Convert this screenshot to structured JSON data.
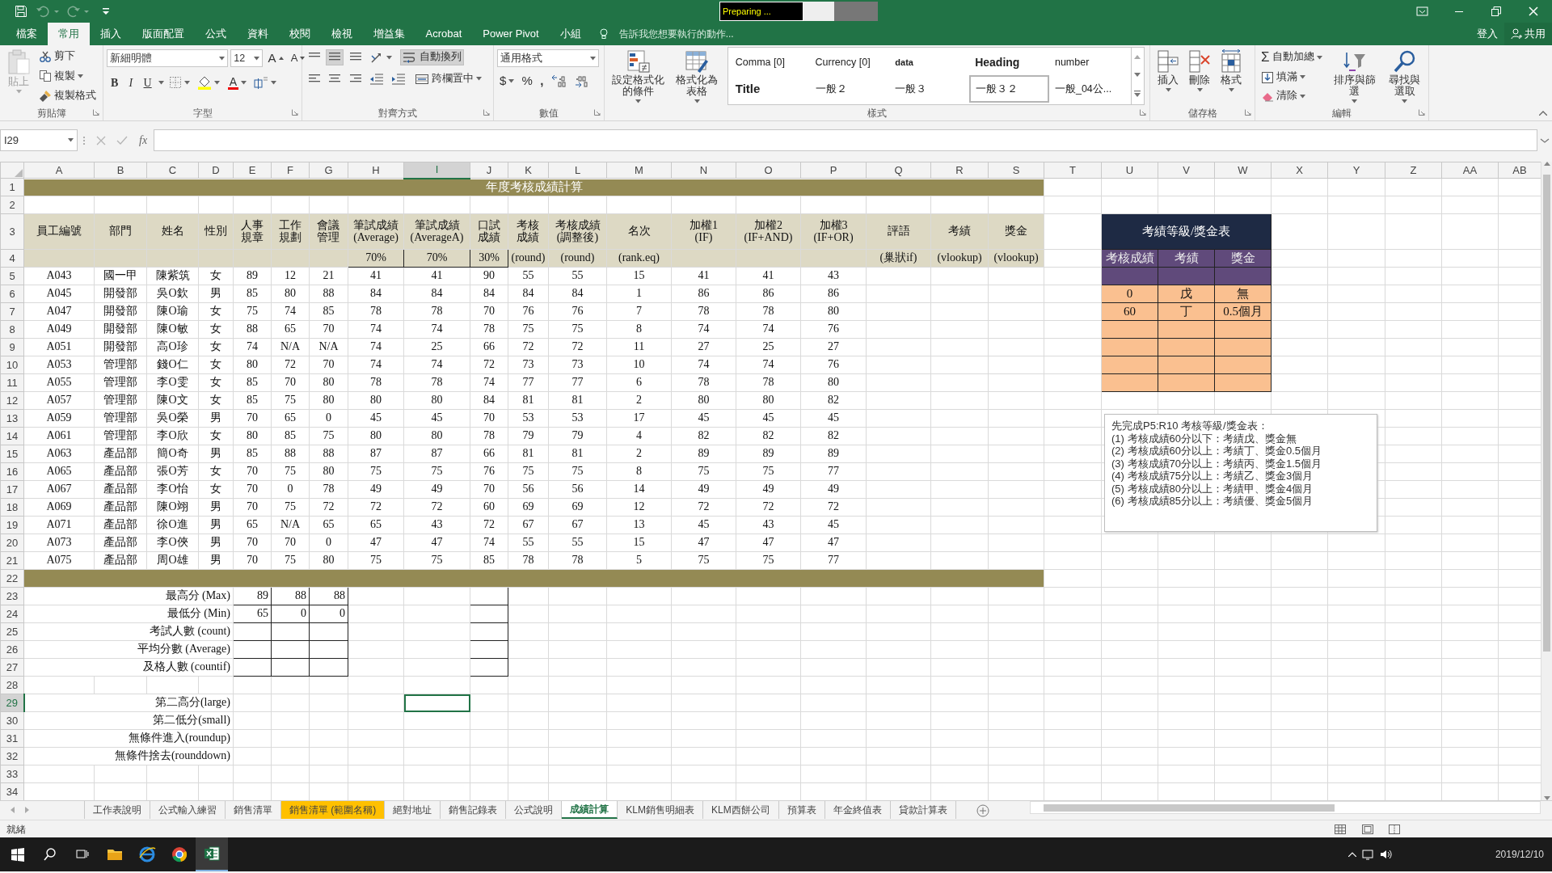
{
  "title_bar": {
    "status_box": "Preparing ..."
  },
  "menu_tabs": [
    {
      "label": "檔案",
      "selected": false
    },
    {
      "label": "常用",
      "selected": true
    },
    {
      "label": "插入",
      "selected": false
    },
    {
      "label": "版面配置",
      "selected": false
    },
    {
      "label": "公式",
      "selected": false
    },
    {
      "label": "資料",
      "selected": false
    },
    {
      "label": "校閱",
      "selected": false
    },
    {
      "label": "檢視",
      "selected": false
    },
    {
      "label": "增益集",
      "selected": false
    },
    {
      "label": "Acrobat",
      "selected": false
    },
    {
      "label": "Power Pivot",
      "selected": false
    },
    {
      "label": "小組",
      "selected": false
    }
  ],
  "tell_me": {
    "placeholder": "告訴我您想要執行的動作..."
  },
  "account": {
    "sign_in": "登入",
    "share": "共用"
  },
  "ribbon": {
    "clipboard": {
      "paste": {
        "label": "貼上",
        "disabled": true
      },
      "cut": "剪下",
      "copy": "複製",
      "format_painter": "複製格式",
      "label": "剪貼簿"
    },
    "font": {
      "font_name": "新細明體",
      "font_size": "12",
      "grow": "A",
      "shrink": "A",
      "bold": "B",
      "italic": "I",
      "underline": "U",
      "font_color": "A",
      "label": "字型"
    },
    "alignment": {
      "wrap_text": {
        "label": "自動換列",
        "on": true
      },
      "merge": "跨欄置中",
      "label": "對齊方式"
    },
    "number": {
      "format": "通用格式",
      "currency": "$",
      "percent": "%",
      "comma": ",",
      "label": "數值"
    },
    "styles": {
      "conditional": "設定格式化的條件",
      "format_table": "格式化為表格",
      "gallery": [
        {
          "name": "Comma [0]",
          "kind": "normal",
          "selected": false
        },
        {
          "name": "Currency [0]",
          "kind": "normal",
          "selected": false
        },
        {
          "name": "data",
          "kind": "small",
          "selected": false
        },
        {
          "name": "Heading",
          "kind": "heading",
          "selected": false
        },
        {
          "name": "number",
          "kind": "normal",
          "selected": false
        },
        {
          "name": "Title",
          "kind": "title",
          "selected": false
        },
        {
          "name": "一般２",
          "kind": "normal",
          "selected": false
        },
        {
          "name": "一般３",
          "kind": "normal",
          "selected": false
        },
        {
          "name": "一般３２",
          "kind": "normal",
          "selected": true
        },
        {
          "name": "一般_04公...",
          "kind": "normal",
          "selected": false
        }
      ],
      "label": "樣式"
    },
    "cells": {
      "insert": "插入",
      "delete": "刪除",
      "format": "格式",
      "label": "儲存格"
    },
    "editing": {
      "autosum_symbol": "Σ",
      "autosum": "自動加總",
      "fill": "填滿",
      "clear": "清除",
      "sort": "排序與篩選",
      "find": "尋找與選取",
      "label": "編輯"
    }
  },
  "formula_bar": {
    "name_box": "I29",
    "fx": "fx"
  },
  "sheet": {
    "columns": [
      {
        "letter": "A",
        "selected": false
      },
      {
        "letter": "B",
        "selected": false
      },
      {
        "letter": "C",
        "selected": false
      },
      {
        "letter": "D",
        "selected": false
      },
      {
        "letter": "E",
        "selected": false
      },
      {
        "letter": "F",
        "selected": false
      },
      {
        "letter": "G",
        "selected": false
      },
      {
        "letter": "H",
        "selected": false
      },
      {
        "letter": "I",
        "selected": true
      },
      {
        "letter": "J",
        "selected": false
      },
      {
        "letter": "K",
        "selected": false
      },
      {
        "letter": "L",
        "selected": false
      },
      {
        "letter": "M",
        "selected": false
      },
      {
        "letter": "N",
        "selected": false
      },
      {
        "letter": "O",
        "selected": false
      },
      {
        "letter": "P",
        "selected": false
      },
      {
        "letter": "Q",
        "selected": false
      },
      {
        "letter": "R",
        "selected": false
      },
      {
        "letter": "S",
        "selected": false
      },
      {
        "letter": "T",
        "selected": false
      },
      {
        "letter": "U",
        "selected": false
      },
      {
        "letter": "V",
        "selected": false
      },
      {
        "letter": "W",
        "selected": false
      },
      {
        "letter": "X",
        "selected": false
      },
      {
        "letter": "Y",
        "selected": false
      },
      {
        "letter": "Z",
        "selected": false
      },
      {
        "letter": "AA",
        "selected": false
      },
      {
        "letter": "AB",
        "selected": false
      }
    ],
    "rows": [
      {
        "number": "1",
        "selected": false
      },
      {
        "number": "2",
        "selected": false
      },
      {
        "number": "3",
        "selected": false
      },
      {
        "number": "4",
        "selected": false
      },
      {
        "number": "5",
        "selected": false
      },
      {
        "number": "6",
        "selected": false
      },
      {
        "number": "7",
        "selected": false
      },
      {
        "number": "8",
        "selected": false
      },
      {
        "number": "9",
        "selected": false
      },
      {
        "number": "10",
        "selected": false
      },
      {
        "number": "11",
        "selected": false
      },
      {
        "number": "12",
        "selected": false
      },
      {
        "number": "13",
        "selected": false
      },
      {
        "number": "14",
        "selected": false
      },
      {
        "number": "15",
        "selected": false
      },
      {
        "number": "16",
        "selected": false
      },
      {
        "number": "17",
        "selected": false
      },
      {
        "number": "18",
        "selected": false
      },
      {
        "number": "19",
        "selected": false
      },
      {
        "number": "20",
        "selected": false
      },
      {
        "number": "21",
        "selected": false
      },
      {
        "number": "22",
        "selected": false
      },
      {
        "number": "23",
        "selected": false
      },
      {
        "number": "24",
        "selected": false
      },
      {
        "number": "25",
        "selected": false
      },
      {
        "number": "26",
        "selected": false
      },
      {
        "number": "27",
        "selected": false
      },
      {
        "number": "28",
        "selected": false
      },
      {
        "number": "29",
        "selected": true
      },
      {
        "number": "30",
        "selected": false
      },
      {
        "number": "31",
        "selected": false
      },
      {
        "number": "32",
        "selected": false
      },
      {
        "number": "33",
        "selected": false
      },
      {
        "number": "34",
        "selected": false
      }
    ],
    "title": "年度考核成績計算",
    "header": [
      {
        "title": "員工編號"
      },
      {
        "title": "部門"
      },
      {
        "title": "姓名"
      },
      {
        "title": "性別"
      },
      {
        "title": "人事規章"
      },
      {
        "title": "工作規劃"
      },
      {
        "title": "會議管理"
      },
      {
        "title": "筆試成績\n(Average)",
        "weight": "70%"
      },
      {
        "title": "筆試成績\n(AverageA)",
        "weight": "70%"
      },
      {
        "title": "口試成績",
        "weight": "30%"
      },
      {
        "title": "考核成績",
        "note": "(round)"
      },
      {
        "title": "考核成績\n(調整後)",
        "note": "(round)"
      },
      {
        "title": "名次",
        "note": "(rank.eq)"
      },
      {
        "title": "加權1\n(IF)"
      },
      {
        "title": "加權2\n(IF+AND)"
      },
      {
        "title": "加權3\n(IF+OR)"
      },
      {
        "title": "評語",
        "note": "(巢狀if)"
      },
      {
        "title": "考績",
        "note": "(vlookup)"
      },
      {
        "title": "獎金",
        "note": "(vlookup)"
      }
    ],
    "records": [
      [
        "A043",
        "國一甲",
        "陳紫筑",
        "女",
        "89",
        "12",
        "21",
        "41",
        "41",
        "90",
        "55",
        "55",
        "15",
        "41",
        "41",
        "43"
      ],
      [
        "A045",
        "開發部",
        "吳O欽",
        "男",
        "85",
        "80",
        "88",
        "84",
        "84",
        "84",
        "84",
        "84",
        "1",
        "86",
        "86",
        "86"
      ],
      [
        "A047",
        "開發部",
        "陳O瑜",
        "女",
        "75",
        "74",
        "85",
        "78",
        "78",
        "70",
        "76",
        "76",
        "7",
        "78",
        "78",
        "80"
      ],
      [
        "A049",
        "開發部",
        "陳O敏",
        "女",
        "88",
        "65",
        "70",
        "74",
        "74",
        "78",
        "75",
        "75",
        "8",
        "74",
        "74",
        "76"
      ],
      [
        "A051",
        "開發部",
        "高O珍",
        "女",
        "74",
        "N/A",
        "N/A",
        "74",
        "25",
        "66",
        "72",
        "72",
        "11",
        "27",
        "25",
        "27"
      ],
      [
        "A053",
        "管理部",
        "錢O仁",
        "女",
        "80",
        "72",
        "70",
        "74",
        "74",
        "72",
        "73",
        "73",
        "10",
        "74",
        "74",
        "76"
      ],
      [
        "A055",
        "管理部",
        "李O雯",
        "女",
        "85",
        "70",
        "80",
        "78",
        "78",
        "74",
        "77",
        "77",
        "6",
        "78",
        "78",
        "80"
      ],
      [
        "A057",
        "管理部",
        "陳O文",
        "女",
        "85",
        "75",
        "80",
        "80",
        "80",
        "84",
        "81",
        "81",
        "2",
        "80",
        "80",
        "82"
      ],
      [
        "A059",
        "管理部",
        "吳O榮",
        "男",
        "70",
        "65",
        "0",
        "45",
        "45",
        "70",
        "53",
        "53",
        "17",
        "45",
        "45",
        "45"
      ],
      [
        "A061",
        "管理部",
        "李O欣",
        "女",
        "80",
        "85",
        "75",
        "80",
        "80",
        "78",
        "79",
        "79",
        "4",
        "82",
        "82",
        "82"
      ],
      [
        "A063",
        "產品部",
        "簡O奇",
        "男",
        "85",
        "88",
        "88",
        "87",
        "87",
        "66",
        "81",
        "81",
        "2",
        "89",
        "89",
        "89"
      ],
      [
        "A065",
        "產品部",
        "張O芳",
        "女",
        "70",
        "75",
        "80",
        "75",
        "75",
        "76",
        "75",
        "75",
        "8",
        "75",
        "75",
        "77"
      ],
      [
        "A067",
        "產品部",
        "李O怡",
        "女",
        "70",
        "0",
        "78",
        "49",
        "49",
        "70",
        "56",
        "56",
        "14",
        "49",
        "49",
        "49"
      ],
      [
        "A069",
        "產品部",
        "陳O翊",
        "男",
        "70",
        "75",
        "72",
        "72",
        "72",
        "60",
        "69",
        "69",
        "12",
        "72",
        "72",
        "72"
      ],
      [
        "A071",
        "產品部",
        "徐O進",
        "男",
        "65",
        "N/A",
        "65",
        "65",
        "43",
        "72",
        "67",
        "67",
        "13",
        "45",
        "43",
        "45"
      ],
      [
        "A073",
        "產品部",
        "李O俠",
        "男",
        "70",
        "70",
        "0",
        "47",
        "47",
        "74",
        "55",
        "55",
        "15",
        "47",
        "47",
        "47"
      ],
      [
        "A075",
        "產品部",
        "周O雄",
        "男",
        "70",
        "75",
        "80",
        "75",
        "75",
        "85",
        "78",
        "78",
        "5",
        "75",
        "75",
        "77"
      ]
    ],
    "summary": [
      {
        "label": "最高分 (Max)",
        "values": [
          "89",
          "88",
          "88"
        ]
      },
      {
        "label": "最低分 (Min)",
        "values": [
          "65",
          "0",
          "0"
        ]
      },
      {
        "label": "考試人數 (count)"
      },
      {
        "label": "平均分數 (Average)"
      },
      {
        "label": "及格人數 (countif)"
      }
    ],
    "functions": [
      "第二高分(large)",
      "第二低分(small)",
      "無條件進入(roundup)",
      "無條件捨去(rounddown)"
    ],
    "grade_table": {
      "title": "考績等級/獎金表",
      "columns": [
        "考核成績",
        "考績",
        "獎金"
      ],
      "rows": [
        [
          "0",
          "戊",
          "無"
        ],
        [
          "60",
          "丁",
          "0.5個月"
        ]
      ]
    },
    "note": [
      "先完成P5:R10 考核等級/獎金表：",
      "(1) 考核成績60分以下：考績戊、獎金無",
      "(2) 考核成績60分以上：考績丁、獎金0.5個月",
      "(3) 考核成績70分以上：考績丙、獎金1.5個月",
      "(4) 考核成績75分以上：考績乙、獎金3個月",
      "(5) 考核成績80分以上：考績甲、獎金4個月",
      "(6) 考核成績85分以上：考績優、獎金5個月"
    ]
  },
  "sheet_tabs": [
    {
      "label": "工作表說明",
      "selected": false
    },
    {
      "label": "公式輸入練習",
      "selected": false
    },
    {
      "label": "銷售清單",
      "selected": false
    },
    {
      "label": "銷售清單 (範圍名稱)",
      "selected": false,
      "color": "#ffc000"
    },
    {
      "label": "絕對地址",
      "selected": false
    },
    {
      "label": "銷售記錄表",
      "selected": false
    },
    {
      "label": "公式說明",
      "selected": false
    },
    {
      "label": "成績計算",
      "selected": true
    },
    {
      "label": "KLM銷售明細表",
      "selected": false
    },
    {
      "label": "KLM西餅公司",
      "selected": false
    },
    {
      "label": "預算表",
      "selected": false
    },
    {
      "label": "年金終值表",
      "selected": false
    },
    {
      "label": "貸款計算表",
      "selected": false
    }
  ],
  "status_bar": {
    "text": "就緒"
  },
  "taskbar": {
    "date": "2019/12/10"
  }
}
